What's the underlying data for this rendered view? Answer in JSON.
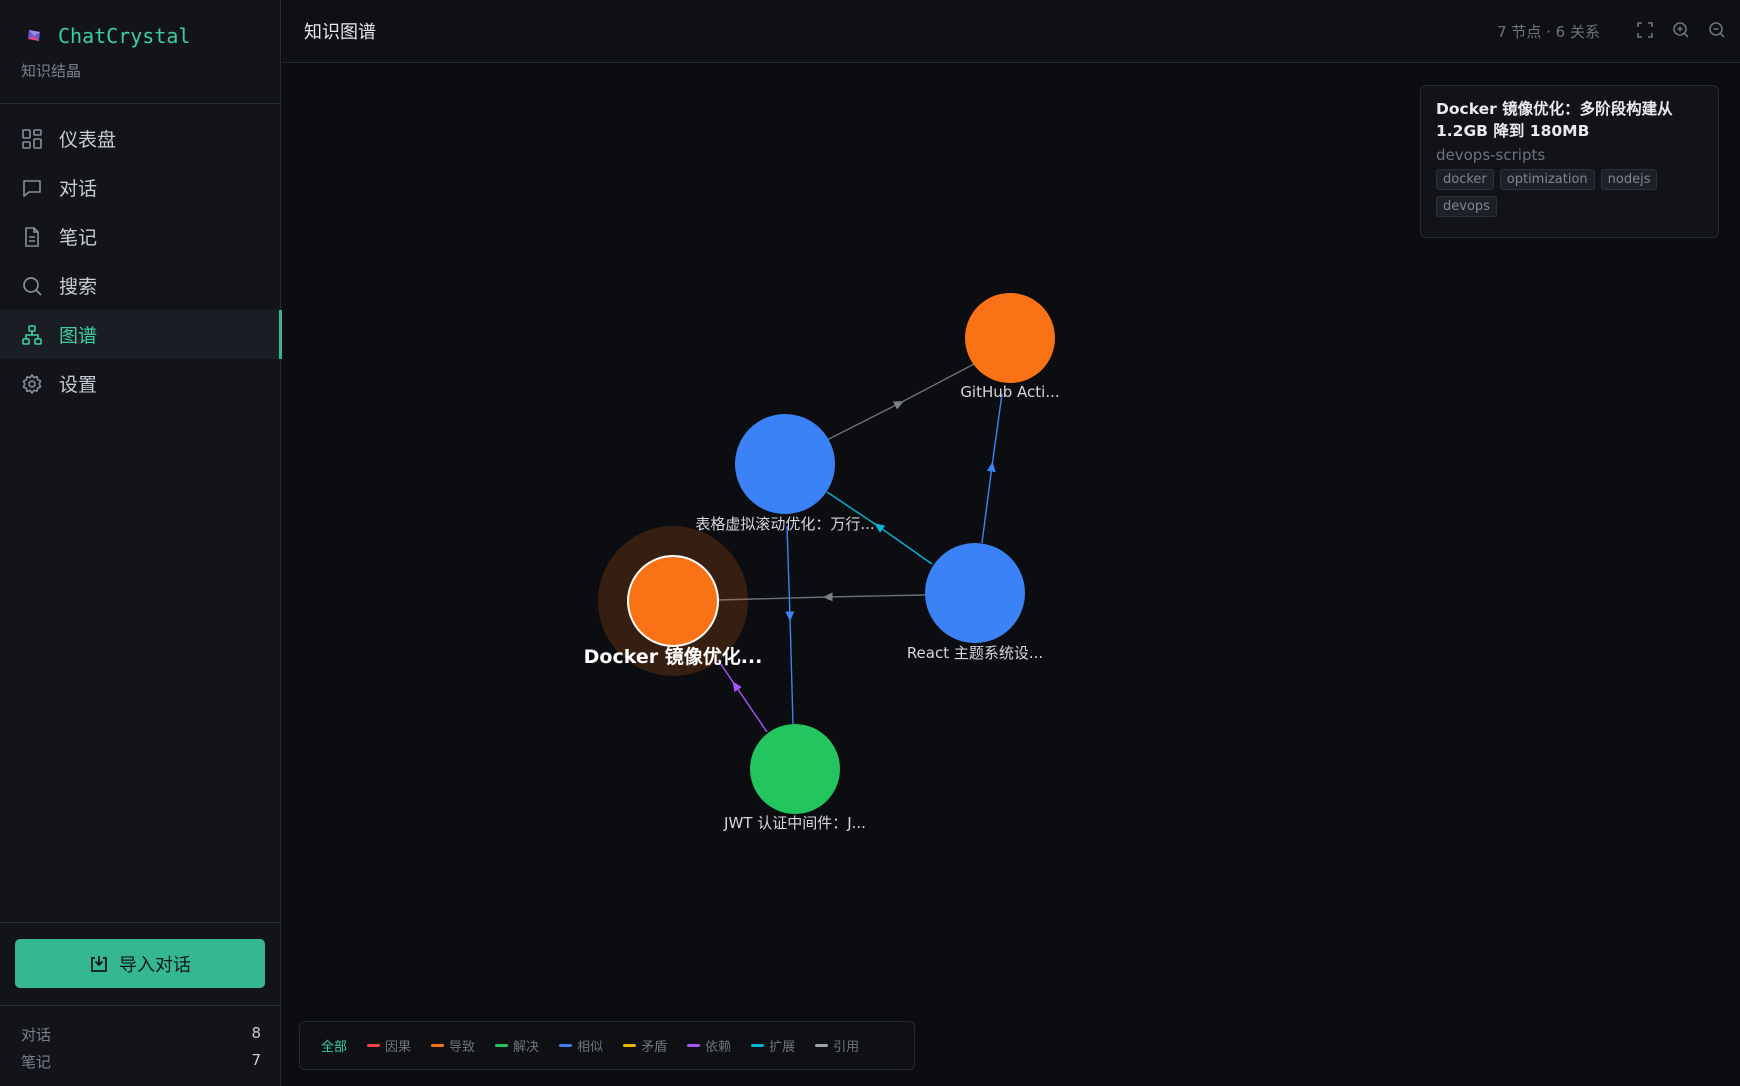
{
  "brand": {
    "name": "ChatCrystal",
    "subtitle": "知识结晶"
  },
  "nav": [
    {
      "label": "仪表盘",
      "icon": "dashboard-icon",
      "active": false
    },
    {
      "label": "对话",
      "icon": "chat-icon",
      "active": false
    },
    {
      "label": "笔记",
      "icon": "note-icon",
      "active": false
    },
    {
      "label": "搜索",
      "icon": "search-icon",
      "active": false
    },
    {
      "label": "图谱",
      "icon": "graph-icon",
      "active": true
    },
    {
      "label": "设置",
      "icon": "settings-icon",
      "active": false
    }
  ],
  "import_button": {
    "label": "导入对话"
  },
  "stats": [
    {
      "label": "对话",
      "value": "8"
    },
    {
      "label": "笔记",
      "value": "7"
    }
  ],
  "header": {
    "title": "知识图谱",
    "counts": "7 节点 · 6 关系"
  },
  "toolbar_icons": [
    "fullscreen-icon",
    "zoom-in-icon",
    "zoom-out-icon"
  ],
  "selected": {
    "title": "Docker 镜像优化：多阶段构建从 1.2GB 降到 180MB",
    "project": "devops-scripts",
    "tags": [
      "docker",
      "optimization",
      "nodejs",
      "devops"
    ]
  },
  "colors": {
    "accent": "#3ecf9e",
    "node_orange": "#f97316",
    "node_blue": "#3b82f6",
    "node_green": "#22c55e"
  },
  "graph": {
    "nodes": [
      {
        "id": "github",
        "label": "GitHub Acti...",
        "color": "#f97316"
      },
      {
        "id": "table",
        "label": "表格虚拟滚动优化：万行...",
        "color": "#3b82f6"
      },
      {
        "id": "docker",
        "label": "Docker 镜像优化...",
        "color": "#f97316",
        "selected": true
      },
      {
        "id": "react",
        "label": "React 主题系统设...",
        "color": "#3b82f6"
      },
      {
        "id": "jwt",
        "label": "JWT 认证中间件：J...",
        "color": "#22c55e"
      }
    ],
    "edges": [
      {
        "from": "table",
        "to": "github",
        "type": "引用"
      },
      {
        "from": "react",
        "to": "github",
        "type": "相似"
      },
      {
        "from": "react",
        "to": "table",
        "type": "扩展"
      },
      {
        "from": "react",
        "to": "docker",
        "type": "引用"
      },
      {
        "from": "table",
        "to": "jwt",
        "type": "相似"
      },
      {
        "from": "jwt",
        "to": "docker",
        "type": "依赖"
      }
    ]
  },
  "legend": [
    {
      "label": "全部",
      "color": "",
      "active": true
    },
    {
      "label": "因果",
      "color": "#ef4444"
    },
    {
      "label": "导致",
      "color": "#f97316"
    },
    {
      "label": "解决",
      "color": "#22c55e"
    },
    {
      "label": "相似",
      "color": "#3b82f6"
    },
    {
      "label": "矛盾",
      "color": "#eab308"
    },
    {
      "label": "依赖",
      "color": "#a855f7"
    },
    {
      "label": "扩展",
      "color": "#06b6d4"
    },
    {
      "label": "引用",
      "color": "#9ca3af"
    }
  ]
}
